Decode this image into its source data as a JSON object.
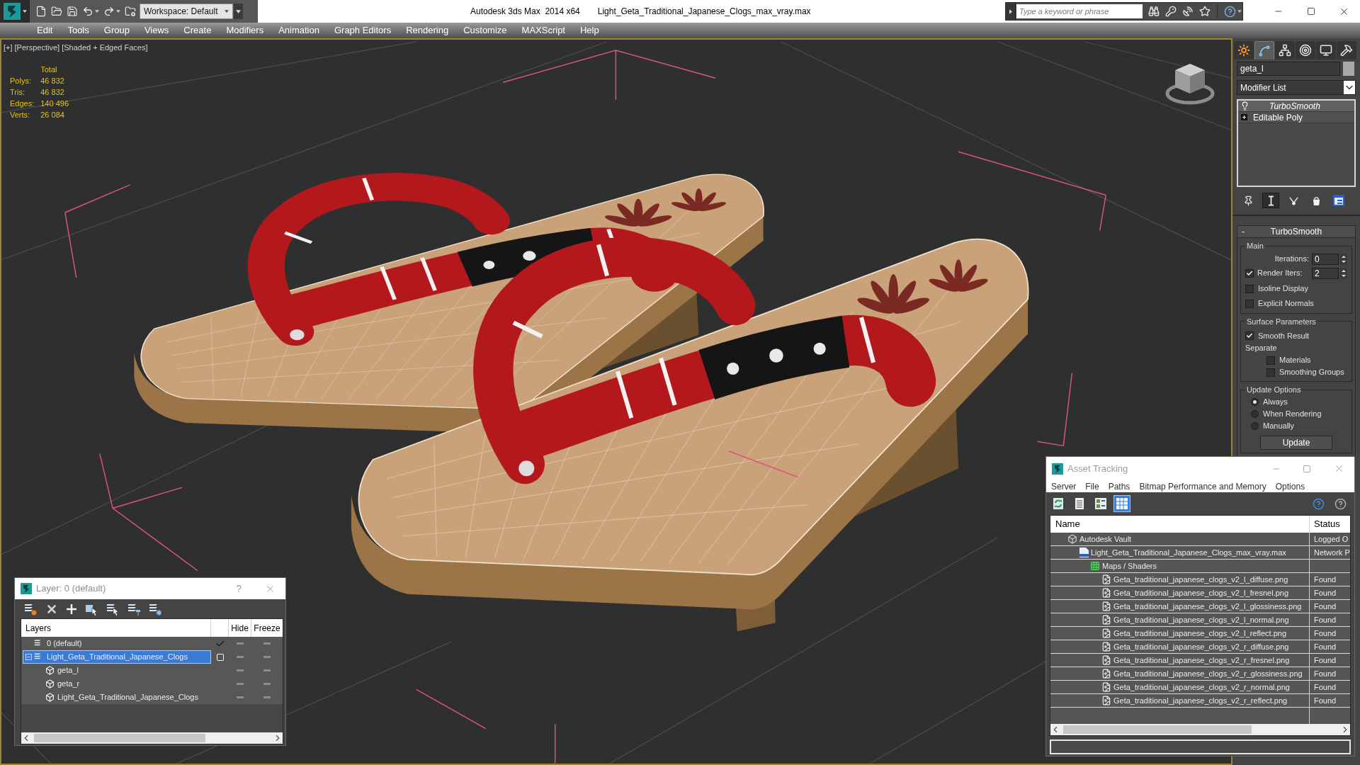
{
  "title_bar": {
    "workspace": "Workspace: Default",
    "app_title": "Autodesk 3ds Max  2014 x64",
    "file_name": "Light_Geta_Traditional_Japanese_Clogs_max_vray.max",
    "search": {
      "placeholder": "Type a keyword or phrase"
    }
  },
  "menu": [
    "Edit",
    "Tools",
    "Group",
    "Views",
    "Create",
    "Modifiers",
    "Animation",
    "Graph Editors",
    "Rendering",
    "Customize",
    "MAXScript",
    "Help"
  ],
  "viewport": {
    "labels": [
      "[+]",
      "[Perspective]",
      "[Shaded + Edged Faces]"
    ],
    "stats": {
      "header": "Total",
      "rows": [
        {
          "label": "Polys:",
          "value": "46 832"
        },
        {
          "label": "Tris:",
          "value": "46 832"
        },
        {
          "label": "Edges:",
          "value": "140 496"
        },
        {
          "label": "Verts:",
          "value": "26 084"
        }
      ]
    }
  },
  "command_panel": {
    "tabs": [
      {
        "selected": false
      },
      {
        "selected": true
      },
      {
        "selected": false
      },
      {
        "selected": false
      },
      {
        "selected": false
      },
      {
        "selected": false
      }
    ],
    "object_name": "geta_l",
    "modifier_list": "Modifier List",
    "stack": [
      {
        "kind": "modifier",
        "name": "TurboSmooth",
        "selected": true
      },
      {
        "kind": "base_object",
        "name": "Editable Poly",
        "selected": false
      }
    ],
    "stack_tools": [
      {
        "on": false
      },
      {
        "on": true
      },
      {
        "on": false
      },
      {
        "on": false
      },
      {
        "on": false
      }
    ],
    "rollout": {
      "toggle": "-",
      "title": "TurboSmooth",
      "groups": [
        {
          "title": "Main",
          "controls": [
            {
              "kind": "spinner",
              "label": "Iterations:",
              "value": "0"
            },
            {
              "kind": "check_spinner",
              "label": "Render Iters:",
              "checked": true,
              "value": "2"
            },
            {
              "kind": "checkbox",
              "label": "Isoline Display",
              "checked": false
            },
            {
              "kind": "checkbox",
              "label": "Explicit Normals",
              "checked": false
            }
          ]
        },
        {
          "title": "Surface Parameters",
          "controls": [
            {
              "kind": "checkbox",
              "label": "Smooth Result",
              "checked": true
            },
            {
              "kind": "label",
              "label": "Separate"
            },
            {
              "kind": "sub_checkbox",
              "label": "Materials",
              "checked": false
            },
            {
              "kind": "sub_checkbox",
              "label": "Smoothing Groups",
              "checked": false
            }
          ]
        },
        {
          "title": "Update Options",
          "controls": [
            {
              "kind": "radio",
              "label": "Always",
              "selected": true
            },
            {
              "kind": "radio",
              "label": "When Rendering",
              "selected": false
            },
            {
              "kind": "radio",
              "label": "Manually",
              "selected": false
            },
            {
              "kind": "button",
              "label": "Update"
            }
          ]
        }
      ]
    }
  },
  "asset_tracking": {
    "title": "Asset Tracking",
    "menu": [
      "Server",
      "File",
      "Paths",
      "Bitmap Performance and Memory",
      "Options"
    ],
    "view_buttons": [
      {
        "selected": false
      },
      {
        "selected": false
      },
      {
        "selected": false
      },
      {
        "selected": true
      }
    ],
    "columns": [
      "Name",
      "Status"
    ],
    "tree": [
      {
        "kind": "vault",
        "name": "Autodesk Vault",
        "status": "Logged O",
        "children": [
          {
            "kind": "max_file",
            "name": "Light_Geta_Traditional_Japanese_Clogs_max_vray.max",
            "status": "Network P",
            "children": [
              {
                "kind": "folder",
                "name": "Maps / Shaders",
                "children": [
                  {
                    "kind": "bitmap",
                    "name": "Geta_traditional_japanese_clogs_v2_l_diffuse.png",
                    "status": "Found"
                  },
                  {
                    "kind": "bitmap",
                    "name": "Geta_traditional_japanese_clogs_v2_l_fresnel.png",
                    "status": "Found"
                  },
                  {
                    "kind": "bitmap",
                    "name": "Geta_traditional_japanese_clogs_v2_l_glossiness.png",
                    "status": "Found"
                  },
                  {
                    "kind": "bitmap",
                    "name": "Geta_traditional_japanese_clogs_v2_l_normal.png",
                    "status": "Found"
                  },
                  {
                    "kind": "bitmap",
                    "name": "Geta_traditional_japanese_clogs_v2_l_reflect.png",
                    "status": "Found"
                  },
                  {
                    "kind": "bitmap",
                    "name": "Geta_traditional_japanese_clogs_v2_r_diffuse.png",
                    "status": "Found"
                  },
                  {
                    "kind": "bitmap",
                    "name": "Geta_traditional_japanese_clogs_v2_r_fresnel.png",
                    "status": "Found"
                  },
                  {
                    "kind": "bitmap",
                    "name": "Geta_traditional_japanese_clogs_v2_r_glossiness.png",
                    "status": "Found"
                  },
                  {
                    "kind": "bitmap",
                    "name": "Geta_traditional_japanese_clogs_v2_r_normal.png",
                    "status": "Found"
                  },
                  {
                    "kind": "bitmap",
                    "name": "Geta_traditional_japanese_clogs_v2_r_reflect.png",
                    "status": "Found"
                  }
                ]
              }
            ]
          }
        ]
      }
    ]
  },
  "layer_dialog": {
    "title": "Layer: 0 (default)",
    "help": "?",
    "columns": [
      "Layers",
      "Hide",
      "Freeze"
    ],
    "layers": [
      {
        "kind": "layer",
        "name": "0 (default)",
        "selected": false,
        "current": true,
        "hidden": false,
        "frozen": false
      },
      {
        "kind": "layer",
        "name": "Light_Geta_Traditional_Japanese_Clogs",
        "selected": true,
        "current": false,
        "expanded": true,
        "hidden": false,
        "frozen": false,
        "children": [
          {
            "kind": "object",
            "name": "geta_l",
            "selected": false,
            "hidden": false,
            "frozen": false
          },
          {
            "kind": "object",
            "name": "geta_r",
            "selected": false,
            "hidden": false,
            "frozen": false
          },
          {
            "kind": "object",
            "name": "Light_Geta_Traditional_Japanese_Clogs",
            "selected": false,
            "hidden": false,
            "frozen": false
          }
        ]
      }
    ]
  }
}
